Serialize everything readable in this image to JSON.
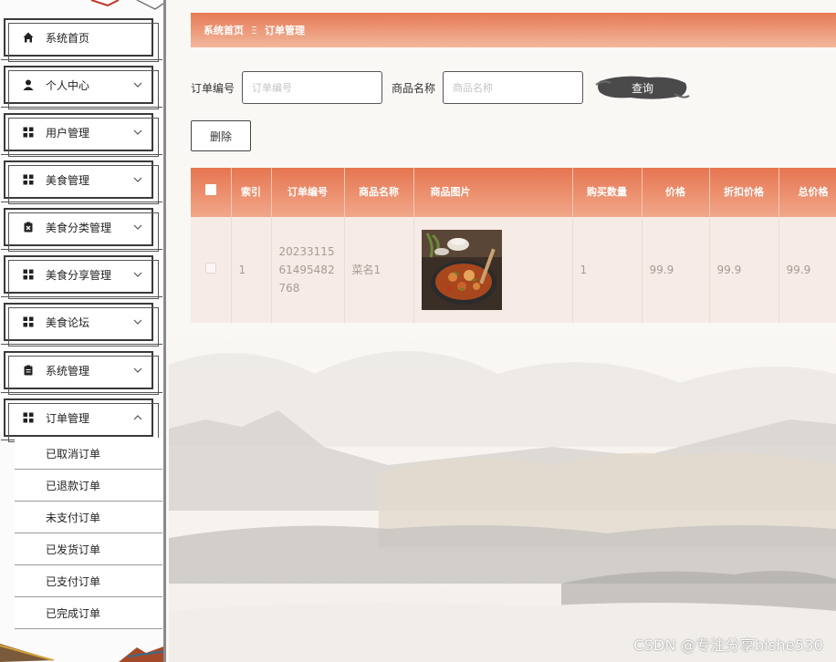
{
  "sidebar": {
    "menu": [
      {
        "label": "系统首页",
        "icon": "home-icon",
        "expandable": false
      },
      {
        "label": "个人中心",
        "icon": "user-icon",
        "expandable": true
      },
      {
        "label": "用户管理",
        "icon": "grid-icon",
        "expandable": true
      },
      {
        "label": "美食管理",
        "icon": "grid-icon",
        "expandable": true
      },
      {
        "label": "美食分类管理",
        "icon": "clipboard-x-icon",
        "expandable": true
      },
      {
        "label": "美食分享管理",
        "icon": "grid-icon",
        "expandable": true
      },
      {
        "label": "美食论坛",
        "icon": "grid-icon",
        "expandable": true
      },
      {
        "label": "系统管理",
        "icon": "clipboard-icon",
        "expandable": true
      },
      {
        "label": "订单管理",
        "icon": "grid-icon",
        "expandable": true,
        "expanded": true
      }
    ],
    "submenu": [
      "已取消订单",
      "已退款订单",
      "未支付订单",
      "已发货订单",
      "已支付订单",
      "已完成订单"
    ]
  },
  "breadcrumb": {
    "home": "系统首页",
    "separator": "Ξ",
    "current": "订单管理"
  },
  "search": {
    "order_no_label": "订单编号",
    "order_no_placeholder": "订单编号",
    "product_name_label": "商品名称",
    "product_name_placeholder": "商品名称",
    "query_button": "查询"
  },
  "actions": {
    "delete_button": "删除"
  },
  "table": {
    "headers": [
      "",
      "索引",
      "订单编号",
      "商品名称",
      "商品图片",
      "购买数量",
      "价格",
      "折扣价格",
      "总价格"
    ],
    "rows": [
      {
        "index": "1",
        "order_no_lines": [
          "20233115",
          "61495482",
          "768"
        ],
        "product_name": "菜名1",
        "image": "food-dish-image",
        "quantity": "1",
        "price": "99.9",
        "discount_price": "99.9",
        "total_price": "99.9"
      }
    ]
  },
  "colors": {
    "accent": "#e67a56",
    "accent_light": "#f2b79c",
    "row_bg": "#f6ebe6"
  },
  "watermark": "CSDN @专注分享bishe530"
}
